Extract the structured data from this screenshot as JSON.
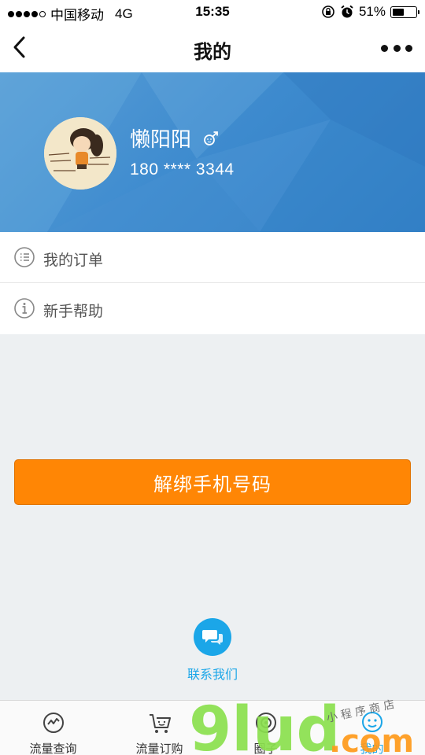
{
  "status_bar": {
    "carrier": "中国移动",
    "network": "4G",
    "time": "15:35",
    "battery": "51%",
    "battery_level": 0.51
  },
  "nav": {
    "title": "我的"
  },
  "profile": {
    "name": "懒阳阳",
    "phone": "180 **** 3344",
    "gender_icon": "male-gender-icon"
  },
  "menu": {
    "items": [
      {
        "label": "我的订单",
        "icon": "order-list-icon"
      },
      {
        "label": "新手帮助",
        "icon": "help-info-icon"
      }
    ]
  },
  "unbind_button": {
    "label": "解绑手机号码",
    "color": "#ff8605"
  },
  "contact": {
    "label": "联系我们"
  },
  "tabbar": {
    "tabs": [
      {
        "label": "流量查询",
        "icon": "traffic-query-icon"
      },
      {
        "label": "流量订购",
        "icon": "shopping-cart-icon"
      },
      {
        "label": "圈子",
        "icon": "circle-icon"
      },
      {
        "label": "我的",
        "icon": "profile-face-icon",
        "active": true
      }
    ]
  },
  "watermark": {
    "text_main": "9lud",
    "text_tld": ".com",
    "text_sub": "小程序商店"
  },
  "colors": {
    "accent": "#1ba6e8",
    "profile_bg": "#3f8ccf",
    "button": "#ff8605"
  }
}
